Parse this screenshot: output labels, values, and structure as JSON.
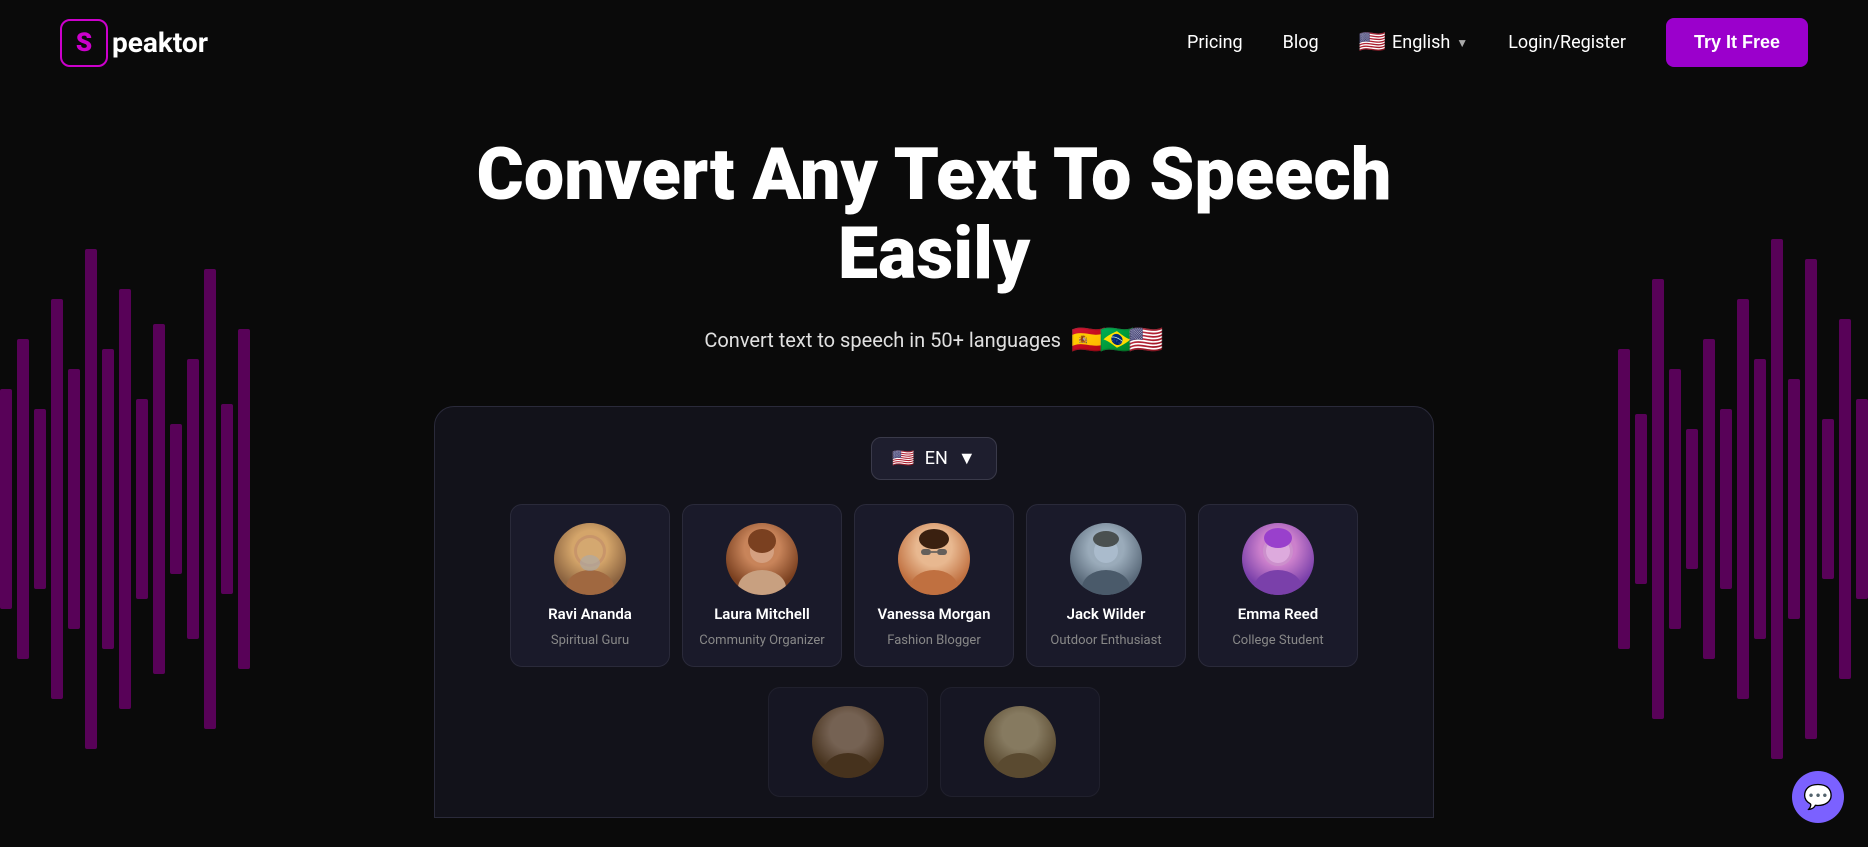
{
  "brand": {
    "logo_letter": "S",
    "logo_name": "peaktor"
  },
  "nav": {
    "pricing_label": "Pricing",
    "blog_label": "Blog",
    "language_label": "English",
    "login_label": "Login/Register",
    "try_btn_label": "Try It Free"
  },
  "hero": {
    "title": "Convert Any Text To Speech Easily",
    "subtitle": "Convert text to speech in 50+ languages"
  },
  "demo": {
    "lang_selector": "EN",
    "voices": [
      {
        "name": "Ravi Ananda",
        "role": "Spiritual Guru",
        "avatar_class": "avatar-ravi",
        "emoji": "🧔"
      },
      {
        "name": "Laura Mitchell",
        "role": "Community Organizer",
        "avatar_class": "avatar-laura",
        "emoji": "👩"
      },
      {
        "name": "Vanessa Morgan",
        "role": "Fashion Blogger",
        "avatar_class": "avatar-vanessa",
        "emoji": "🕶️"
      },
      {
        "name": "Jack Wilder",
        "role": "Outdoor Enthusiast",
        "avatar_class": "avatar-jack",
        "emoji": "👨"
      },
      {
        "name": "Emma Reed",
        "role": "College Student",
        "avatar_class": "avatar-emma",
        "emoji": "💜"
      }
    ]
  },
  "chat": {
    "icon": "💬"
  }
}
